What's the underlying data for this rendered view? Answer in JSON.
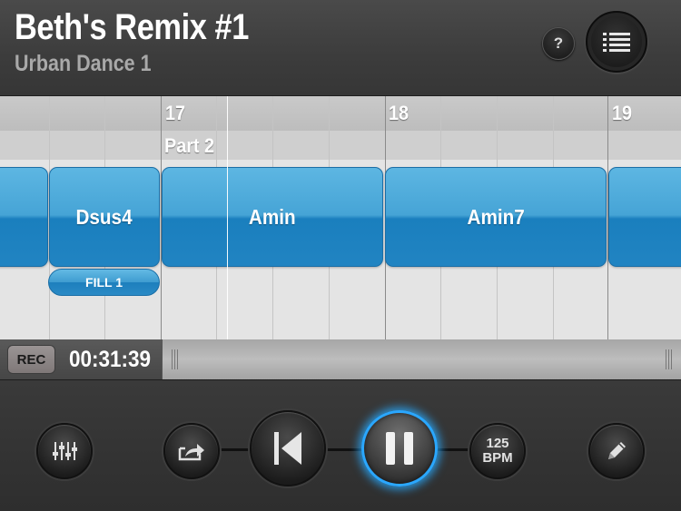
{
  "header": {
    "title": "Beth's Remix #1",
    "subtitle": "Urban Dance 1",
    "help_label": "?",
    "help_icon": "question-icon",
    "list_icon": "list-icon"
  },
  "timeline": {
    "bar_numbers": [
      "17",
      "18",
      "19"
    ],
    "part_label": "Part 2",
    "chords": [
      "Dsus4",
      "Amin",
      "Amin7"
    ],
    "fill_label": "FILL 1",
    "chord_color": "#2f93cf"
  },
  "status": {
    "rec_label": "REC",
    "time": "00:31:39"
  },
  "controls": {
    "mixer_icon": "mixer-sliders-icon",
    "share_icon": "share-icon",
    "rewind_icon": "skip-to-start-icon",
    "pause_icon": "pause-icon",
    "tempo_value": "125",
    "tempo_unit": "BPM",
    "edit_icon": "pencil-icon",
    "accent_color": "#2aa7ff"
  }
}
